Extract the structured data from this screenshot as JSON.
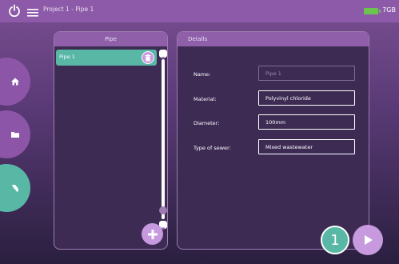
{
  "header": {
    "title": "Project 1 - Pipe 1",
    "storage_label": "7GB",
    "battery_color": "#6cc44f"
  },
  "icons": {
    "power": "power-icon",
    "menu": "hamburger-menu-icon",
    "home": "home-icon",
    "folder": "folder-icon",
    "pipe": "pipe-icon",
    "trash": "trash-icon",
    "add": "plus-icon",
    "next": "play-icon"
  },
  "pipe_panel": {
    "title": "Pipe",
    "items": [
      {
        "label": "Pipe 1"
      }
    ]
  },
  "details_panel": {
    "title": "Details",
    "fields": [
      {
        "label": "Name:",
        "value": "Pipe 1"
      },
      {
        "label": "Material:",
        "value": "Polyvinyl chloride"
      },
      {
        "label": "Diameter:",
        "value": "100mm"
      },
      {
        "label": "Type of sewer:",
        "value": "Mixed wastewater"
      }
    ]
  },
  "step": {
    "number": "1"
  },
  "colors": {
    "accent_teal": "#58b7a5",
    "accent_purple": "#8c55a8",
    "light_purple": "#c79adf"
  }
}
